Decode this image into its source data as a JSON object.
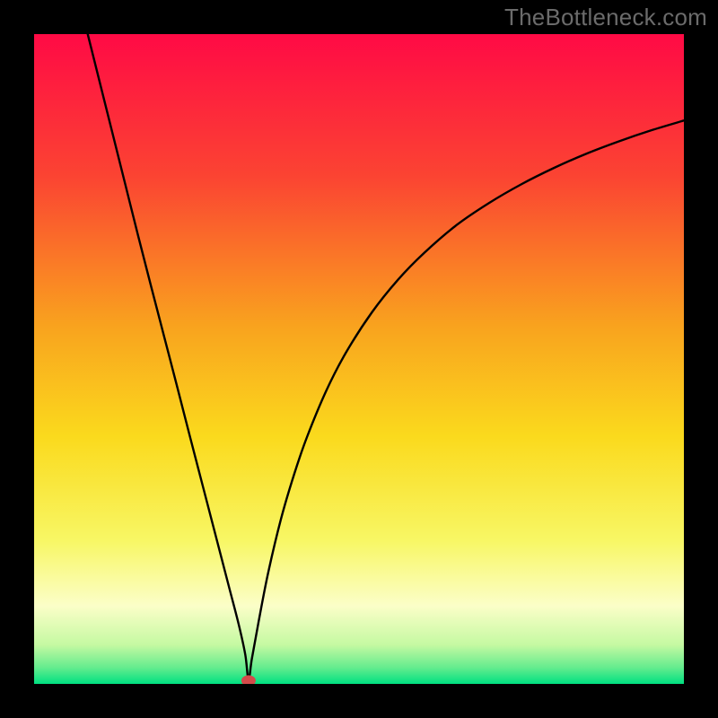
{
  "watermark": "TheBottleneck.com",
  "chart_data": {
    "type": "line",
    "title": "",
    "xlabel": "",
    "ylabel": "",
    "x_range": [
      0,
      100
    ],
    "y_range": [
      0,
      100
    ],
    "grid": false,
    "legend": false,
    "marker": {
      "x": 33,
      "y": 0.5,
      "color": "#d34a4a"
    },
    "series": [
      {
        "name": "curve",
        "color": "#000000",
        "x": [
          8,
          10,
          12,
          14,
          16,
          18,
          20,
          22,
          24,
          26,
          28,
          30,
          31.5,
          32.5,
          33,
          33.5,
          34.5,
          36,
          38,
          40,
          42,
          45,
          48,
          52,
          56,
          60,
          65,
          70,
          75,
          80,
          85,
          90,
          95,
          100
        ],
        "y": [
          101,
          93,
          85,
          77,
          69,
          61.2,
          53.5,
          45.8,
          38,
          30.3,
          22.6,
          14.9,
          9.1,
          4.5,
          0.6,
          3.8,
          9.3,
          17,
          25.4,
          32.2,
          38.0,
          45.2,
          51.0,
          57.2,
          62.2,
          66.3,
          70.6,
          74.0,
          76.9,
          79.4,
          81.6,
          83.5,
          85.2,
          86.7
        ]
      }
    ],
    "background_gradient": [
      {
        "stop": 0.0,
        "color": "#ff0a45"
      },
      {
        "stop": 0.22,
        "color": "#fb4432"
      },
      {
        "stop": 0.45,
        "color": "#f9a31e"
      },
      {
        "stop": 0.62,
        "color": "#fada1d"
      },
      {
        "stop": 0.78,
        "color": "#f8f765"
      },
      {
        "stop": 0.88,
        "color": "#fbfec8"
      },
      {
        "stop": 0.94,
        "color": "#c5f9a2"
      },
      {
        "stop": 0.975,
        "color": "#64ec8e"
      },
      {
        "stop": 1.0,
        "color": "#00e081"
      }
    ]
  }
}
